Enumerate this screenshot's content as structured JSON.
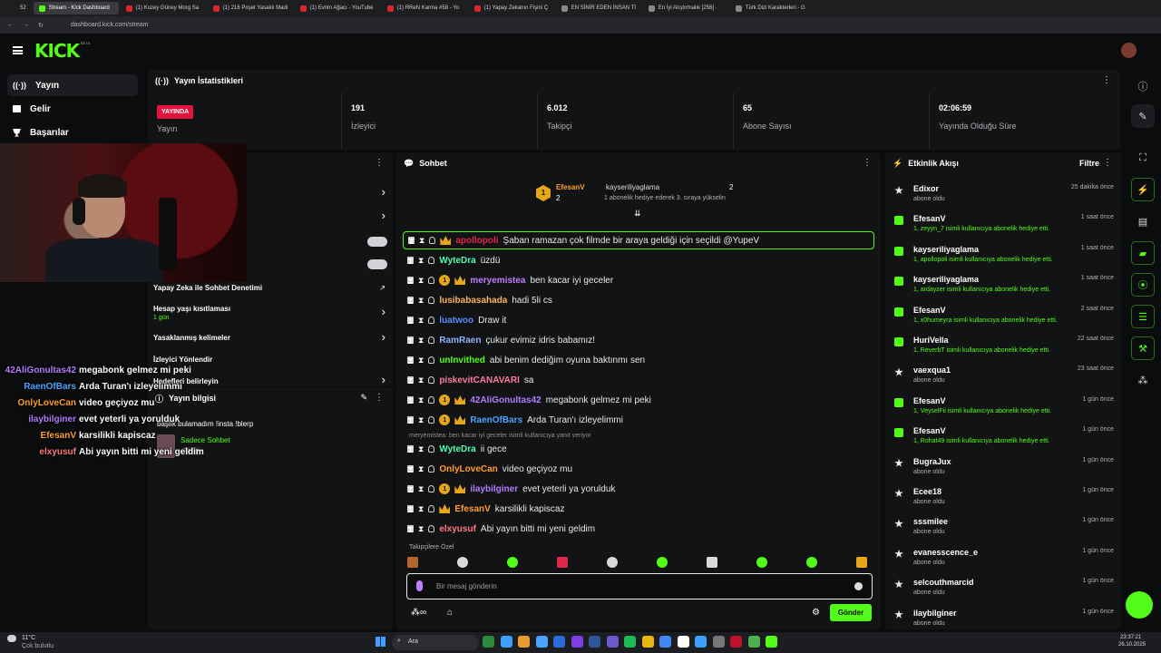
{
  "browser": {
    "tabs": [
      "Stream - Kick Dashboard",
      "(1) Kuzey Güney Morg Sa",
      "(1) 216 Poşet Yasaklı Madi",
      "(1) Evrim Ağacı - YouTube",
      "(1) RReN Karma #58 - Yo",
      "(1) Yapay Zekanın Fişini Ç",
      "EN SİNİR EDEN İNSAN Tİ",
      "En İyi Atıştırmalık [256] ·",
      "Türk Dizi Karakterleri - G"
    ],
    "tab_count": "52",
    "url": "dashboard.kick.com/stream"
  },
  "site": {
    "logo": "KICK",
    "beta": "BETA"
  },
  "nav": {
    "items": [
      {
        "label": "Yayın"
      },
      {
        "label": "Gelir"
      },
      {
        "label": "Başarılar"
      }
    ]
  },
  "stats": {
    "title": "Yayın İstatistikleri",
    "live_badge": "YAYINDA",
    "live_label": "Yayın",
    "viewers_value": "191",
    "viewers_label": "İzleyici",
    "followers_value": "6.012",
    "followers_label": "Takipçi",
    "subs_value": "65",
    "subs_label": "Abone Sayısı",
    "duration_value": "02:06:59",
    "duration_label": "Yayında Olduğu Süre"
  },
  "mod": {
    "ai": "Yapay Zeka ile Sohbet Denetimi",
    "age_title": "Hesap yaşı kısıtlaması",
    "age_value": "1 gün",
    "banned": "Yasaklanmış kelimeler",
    "raid": "İzleyici Yönlendir",
    "goals": "Hedefleri belirleyin",
    "info_title": "Yayın bilgisi",
    "info_text": "başlık bulamadım !insta !blerp",
    "followers_only": "Sadece Sohbet",
    "followers_only_sub": "Takip"
  },
  "overlay": [
    {
      "user": "42AliGonultas42",
      "text": "megabonk gelmez mi peki",
      "color": "#b57cff"
    },
    {
      "user": "RaenOfBars",
      "text": "Arda Turan'ı izleyelimmi",
      "color": "#4aa3ff"
    },
    {
      "user": "OnlyLoveCan",
      "text": "video geçiyoz mu",
      "color": "#ff9d2e"
    },
    {
      "user": "ilaybilginer",
      "text": "evet yeterli ya yorulduk",
      "color": "#b57cff"
    },
    {
      "user": "EfesanV",
      "text": "karsilikli kapiscaz",
      "color": "#ff9d2e"
    },
    {
      "user": "elxyusuf",
      "text": "Abi yayın bitti mi yeni geldim",
      "color": "#ff7b7b"
    }
  ],
  "chat": {
    "title": "Sohbet",
    "pinned_gifter": "EfesanV",
    "pinned_gifter_count": "2",
    "pinned_recipient": "kayseriliyaglama",
    "pinned_recipient_count": "2",
    "pinned_text": "1 abonelik hediye ederek 3. sıraya yükselin",
    "messages": [
      {
        "user": "apollopoli",
        "text": "Şaban ramazan çok filmde bir araya geldiği için seçildi @YupeV",
        "color": "#e0264a",
        "sub": "",
        "crown": true
      },
      {
        "user": "WyteDra",
        "text": "üzdü",
        "color": "#53fcb0",
        "sub": "",
        "crown": false
      },
      {
        "user": "meryemistea",
        "text": "ben kacar iyi geceler",
        "color": "#c07cff",
        "sub": "1",
        "crown": true
      },
      {
        "user": "lusibabasahada",
        "text": "hadi 5li cs",
        "color": "#ffb35c",
        "sub": "",
        "crown": false
      },
      {
        "user": "luatwoo",
        "text": "Draw it",
        "color": "#5a8cff",
        "sub": "",
        "crown": false
      },
      {
        "user": "RamRaen",
        "text": "çukur evimiz idris babamız!",
        "color": "#8fb4ff",
        "sub": "",
        "crown": false
      },
      {
        "user": "unInvithed",
        "text": "abi benim dediğim oyuna baktınmı sen",
        "color": "#53fc18",
        "sub": "",
        "crown": false
      },
      {
        "user": "piskevitCANAVARI",
        "text": "sa",
        "color": "#ff7b9c",
        "sub": "",
        "crown": false
      },
      {
        "user": "42AliGonultas42",
        "text": "megabonk gelmez mi peki",
        "color": "#b57cff",
        "sub": "1",
        "crown": true
      },
      {
        "user": "RaenOfBars",
        "text": "Arda Turan'ı izleyelimmi",
        "color": "#4aa3ff",
        "sub": "1",
        "crown": true
      }
    ],
    "reply_note": "meryemistea: ben kacar iyi geceler isimli kullanıcıya yanıt veriyor",
    "messages2": [
      {
        "user": "WyteDra",
        "text": "ii gece",
        "color": "#53fcb0",
        "sub": "",
        "crown": false
      },
      {
        "user": "OnlyLoveCan",
        "text": "video geçiyoz mu",
        "color": "#ff9d2e",
        "sub": "",
        "crown": false
      },
      {
        "user": "ilaybilginer",
        "text": "evet yeterli ya yorulduk",
        "color": "#b57cff",
        "sub": "1",
        "crown": true
      },
      {
        "user": "EfesanV",
        "text": "karsilikli kapiscaz",
        "color": "#ff9d2e",
        "sub": "",
        "crown": true
      },
      {
        "user": "elxyusuf",
        "text": "Abi yayın bitti mi yeni geldim",
        "color": "#ff7b7b",
        "sub": "",
        "crown": false
      }
    ],
    "emote_label": "Takipçilere Özel",
    "input_placeholder": "Bir mesaj gönderin",
    "send": "Gönder"
  },
  "events": {
    "title": "Etkinlik Akışı",
    "filter": "Filtre",
    "items": [
      {
        "name": "Edixor",
        "desc": "abone oldu",
        "time": "25 dakika önce",
        "gift": false
      },
      {
        "name": "EfesanV",
        "desc": "1, zeyyn_7 isimli kullanıcıya abonelik hediye etti.",
        "time": "1 saat önce",
        "gift": true
      },
      {
        "name": "kayseriliyaglama",
        "desc": "1, apollopoli isimli kullanıcıya abonelik hediye etti.",
        "time": "1 saat önce",
        "gift": true
      },
      {
        "name": "kayseriliyaglama",
        "desc": "1, ardayzer isimli kullanıcıya abonelik hediye etti.",
        "time": "1 saat önce",
        "gift": true
      },
      {
        "name": "EfesanV",
        "desc": "1, x0humeyra isimli kullanıcıya abonelik hediye etti.",
        "time": "2 saat önce",
        "gift": true
      },
      {
        "name": "HuriVella",
        "desc": "1, ReverbT isimli kullanıcıya abonelik hediye etti.",
        "time": "22 saat önce",
        "gift": true
      },
      {
        "name": "vaexqua1",
        "desc": "abone oldu",
        "time": "23 saat önce",
        "gift": false
      },
      {
        "name": "EfesanV",
        "desc": "1, VeyselFii isimli kullanıcıya abonelik hediye etti.",
        "time": "1 gün önce",
        "gift": true
      },
      {
        "name": "EfesanV",
        "desc": "1, Rohat49 isimli kullanıcıya abonelik hediye etti.",
        "time": "1 gün önce",
        "gift": true
      },
      {
        "name": "BugraJux",
        "desc": "abone oldu",
        "time": "1 gün önce",
        "gift": false
      },
      {
        "name": "Ecee18",
        "desc": "abone oldu",
        "time": "1 gün önce",
        "gift": false
      },
      {
        "name": "sssmilee",
        "desc": "abone oldu",
        "time": "1 gün önce",
        "gift": false
      },
      {
        "name": "evanesscence_e",
        "desc": "abone oldu",
        "time": "1 gün önce",
        "gift": false
      },
      {
        "name": "selcouthmarcid",
        "desc": "abone oldu",
        "time": "1 gün önce",
        "gift": false
      },
      {
        "name": "ilaybilginer",
        "desc": "abone oldu",
        "time": "1 gün önce",
        "gift": false
      }
    ]
  },
  "taskbar": {
    "weather_temp": "11°C",
    "weather_desc": "Çok bulutlu",
    "search": "Ara",
    "time": "23:37:21",
    "date": "26.10.2025"
  }
}
